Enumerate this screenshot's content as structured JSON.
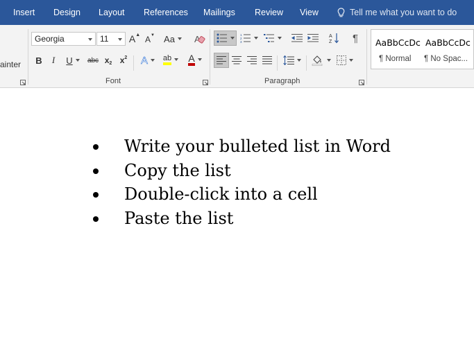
{
  "tabs": [
    "Insert",
    "Design",
    "Layout",
    "References",
    "Mailings",
    "Review",
    "View"
  ],
  "tell_me": "Tell me what you want to do",
  "clipboard": {
    "format_painter_label": "ainter"
  },
  "font_group": {
    "label": "Font",
    "font_name": "Georgia",
    "font_size": "11",
    "grow_font": "A",
    "shrink_font": "A",
    "change_case": "Aa",
    "bold": "B",
    "italic": "I",
    "underline": "U",
    "strikethrough": "abc",
    "subscript": "x",
    "subscript_sub": "2",
    "superscript": "x",
    "superscript_sup": "2",
    "text_effects": "A",
    "highlight": "ab",
    "font_color": "A",
    "highlight_color": "#ffff00",
    "font_color_value": "#c00000"
  },
  "paragraph_group": {
    "label": "Paragraph",
    "pilcrow": "¶"
  },
  "styles": [
    {
      "preview": "AaBbCcDc",
      "name": "¶ Normal"
    },
    {
      "preview": "AaBbCcDc",
      "name": "¶ No Spac..."
    }
  ],
  "document": {
    "list_items": [
      "Write your bulleted list in Word",
      "Copy the list",
      "Double-click into a cell",
      "Paste the list"
    ]
  },
  "colors": {
    "ribbon_blue": "#2b579a",
    "ribbon_bg": "#f3f3f3"
  }
}
